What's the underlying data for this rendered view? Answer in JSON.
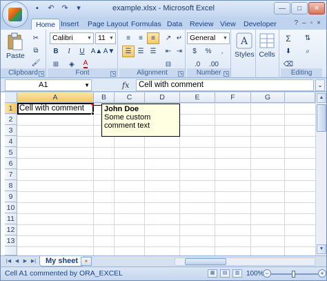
{
  "window": {
    "title": "example.xlsx - Microsoft Excel"
  },
  "quick_access": {
    "icons": [
      "save-icon",
      "undo-icon",
      "redo-icon",
      "customize-icon"
    ]
  },
  "ribbon_tabs": [
    "Home",
    "Insert",
    "Page Layout",
    "Formulas",
    "Data",
    "Review",
    "View",
    "Developer"
  ],
  "ribbon": {
    "clipboard": {
      "paste_label": "Paste",
      "group_label": "Clipboard"
    },
    "font": {
      "name": "Calibri",
      "size": "11",
      "bold": "B",
      "italic": "I",
      "underline": "U",
      "font_color_glyph": "A",
      "group_label": "Font"
    },
    "alignment": {
      "group_label": "Alignment"
    },
    "number": {
      "format": "General",
      "currency": "$",
      "percent": "%",
      "comma": ",",
      "group_label": "Number"
    },
    "styles": {
      "label": "Styles"
    },
    "cells": {
      "label": "Cells"
    },
    "editing": {
      "group_label": "Editing",
      "sum_glyph": "Σ"
    }
  },
  "formula_bar": {
    "name_box": "A1",
    "fx": "fx",
    "value": "Cell with comment"
  },
  "grid": {
    "columns": [
      "A",
      "B",
      "C",
      "D",
      "E",
      "F",
      "G"
    ],
    "rows": [
      "1",
      "2",
      "3",
      "4",
      "5",
      "6",
      "7",
      "8",
      "9",
      "10",
      "11",
      "12",
      "13"
    ],
    "active_cell": "A1",
    "cell_a1": "Cell with comment"
  },
  "comment": {
    "author": "John Doe",
    "text": "Some custom comment text"
  },
  "sheets": {
    "active": "My sheet"
  },
  "status_bar": {
    "text": "Cell A1 commented by ORA_EXCEL",
    "zoom": "100%"
  },
  "colors": {
    "accent": "#15428b",
    "selection": "#f8c964",
    "comment_bg": "#ffffe1"
  }
}
